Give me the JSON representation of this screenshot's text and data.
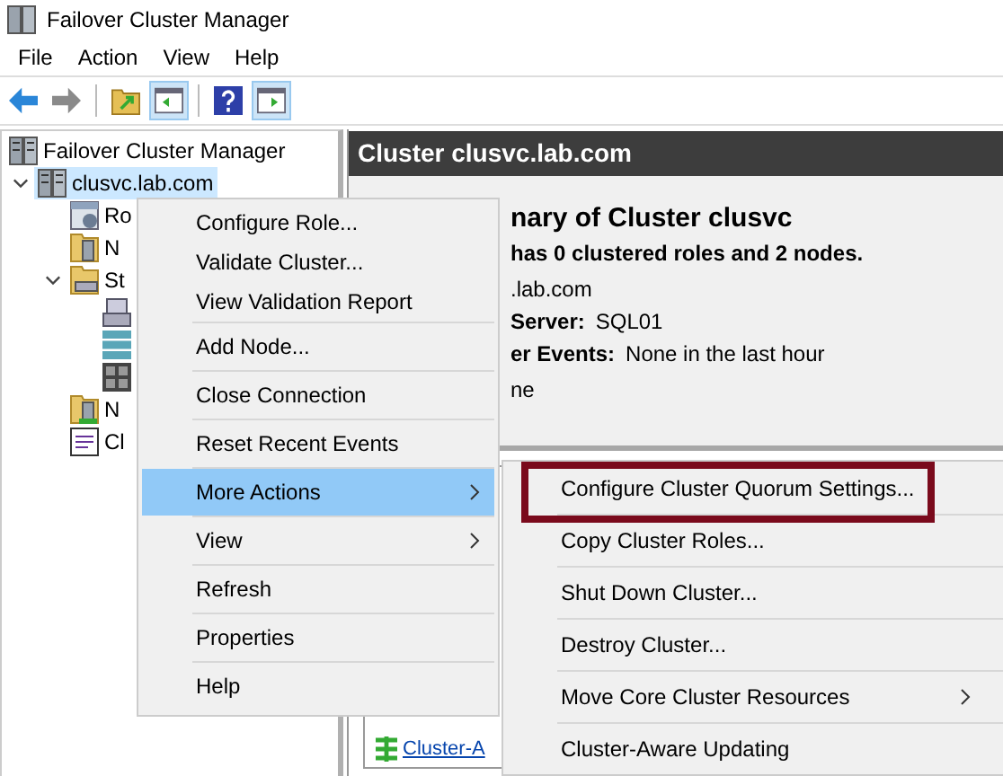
{
  "window": {
    "title": "Failover Cluster Manager"
  },
  "menu_bar": [
    "File",
    "Action",
    "View",
    "Help"
  ],
  "toolbar": [
    {
      "kind": "back",
      "pressed": false
    },
    {
      "kind": "forward",
      "pressed": false
    },
    {
      "kind": "separator"
    },
    {
      "kind": "up",
      "pressed": false
    },
    {
      "kind": "pane",
      "pressed": true
    },
    {
      "kind": "separator"
    },
    {
      "kind": "help",
      "pressed": false
    },
    {
      "kind": "actions",
      "pressed": true
    }
  ],
  "tree": [
    {
      "label": "Failover Cluster Manager",
      "kind": "manager",
      "selected": false,
      "children": [
        {
          "label": "clusvc.lab.com",
          "kind": "cluster",
          "selected": true,
          "expanded": true,
          "children": [
            {
              "label": "Ro",
              "kind": "roles",
              "selected": false
            },
            {
              "label": "N",
              "kind": "nodes",
              "selected": false
            },
            {
              "label": "St",
              "kind": "storage",
              "selected": false,
              "expanded": true,
              "children": [
                {
                  "kind": "disks",
                  "selected": false
                },
                {
                  "kind": "pools",
                  "selected": false
                },
                {
                  "kind": "enclosures",
                  "selected": false
                }
              ]
            },
            {
              "label": "N",
              "kind": "networks",
              "selected": false
            },
            {
              "label": "Cl",
              "kind": "events",
              "selected": false
            }
          ]
        }
      ]
    }
  ],
  "content": {
    "header": "Cluster clusvc.lab.com",
    "summary_title": "nary of Cluster clusvc",
    "summary_line": "has 0 clustered roles and 2 nodes.",
    "fragment": ".lab.com",
    "fields": [
      {
        "label": "Server:",
        "value": "SQL01"
      },
      {
        "label": "er Events:",
        "value": "None in the last hour"
      }
    ],
    "fragment_2": "ne",
    "link": "Cluster-A"
  },
  "context_menu": [
    {
      "label": "Configure Role...",
      "separated": false,
      "submenu": false,
      "selected": false
    },
    {
      "label": "Validate Cluster...",
      "separated": false,
      "submenu": false,
      "selected": false
    },
    {
      "label": "View Validation Report",
      "separated": false,
      "submenu": false,
      "selected": false
    },
    {
      "label": "Add Node...",
      "separated": true,
      "submenu": false,
      "selected": false
    },
    {
      "label": "Close Connection",
      "separated": true,
      "submenu": false,
      "selected": false
    },
    {
      "label": "Reset Recent Events",
      "separated": true,
      "submenu": false,
      "selected": false
    },
    {
      "label": "More Actions",
      "separated": true,
      "submenu": true,
      "selected": true
    },
    {
      "label": "View",
      "separated": true,
      "submenu": true,
      "selected": false
    },
    {
      "label": "Refresh",
      "separated": true,
      "submenu": false,
      "selected": false
    },
    {
      "label": "Properties",
      "separated": true,
      "submenu": false,
      "selected": false
    },
    {
      "label": "Help",
      "separated": true,
      "submenu": false,
      "selected": false
    }
  ],
  "submenu": [
    {
      "label": "Configure Cluster Quorum Settings...",
      "separated": false,
      "submenu": false,
      "highlighted": true
    },
    {
      "label": "Copy Cluster Roles...",
      "separated": true,
      "submenu": false,
      "highlighted": false
    },
    {
      "label": "Shut Down Cluster...",
      "separated": true,
      "submenu": false,
      "highlighted": false
    },
    {
      "label": "Destroy Cluster...",
      "separated": true,
      "submenu": false,
      "highlighted": false
    },
    {
      "label": "Move Core Cluster Resources",
      "separated": true,
      "submenu": true,
      "highlighted": false
    },
    {
      "label": "Cluster-Aware Updating",
      "separated": true,
      "submenu": false,
      "highlighted": false
    }
  ]
}
